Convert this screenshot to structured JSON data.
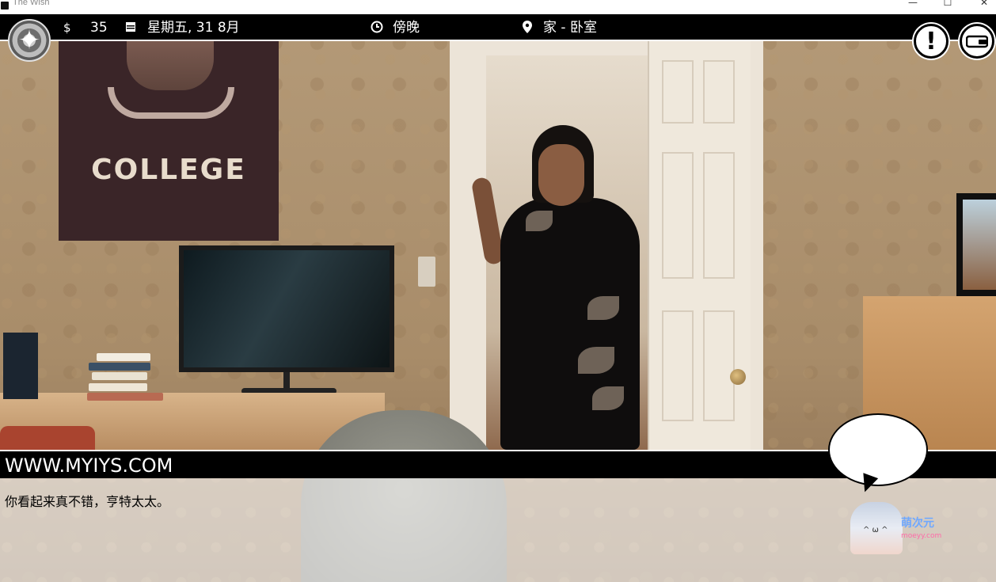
{
  "window": {
    "title": "The Wish",
    "controls": {
      "minimize": "—",
      "maximize": "☐",
      "close": "✕"
    }
  },
  "hud": {
    "money_icon": "$",
    "money": "35",
    "calendar_icon": "calendar-icon",
    "date": "星期五, 31 8月",
    "clock_icon": "clock-icon",
    "time_of_day": "傍晚",
    "location_icon": "map-pin-icon",
    "location": "家 - 卧室",
    "compass_icon": "compass-icon",
    "alert_icon": "exclamation-icon",
    "wallet_icon": "wallet-icon"
  },
  "scene": {
    "poster_text": "COLLEGE"
  },
  "dialogue": {
    "speaker": "WWW.MYIYS.COM",
    "line": "你看起来真不错，亨特太太。"
  },
  "watermark": {
    "title": "萌次元",
    "subtitle": "moeyy.com"
  },
  "colors": {
    "hud_bg": "#000000",
    "hud_text": "#ffffff",
    "dialog_bg": "rgba(255,255,255,0.62)"
  }
}
